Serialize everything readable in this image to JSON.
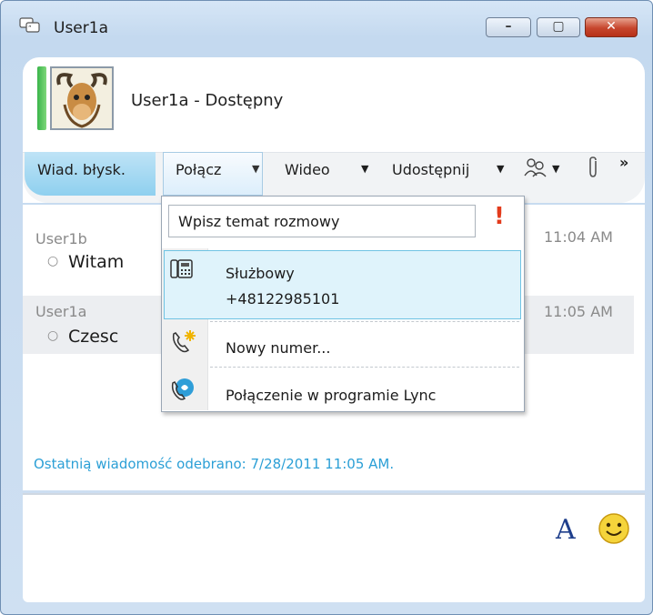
{
  "window": {
    "title": "User1a",
    "minimize_label": "–",
    "maximize_label": "▢",
    "close_label": "✕"
  },
  "contact": {
    "name": "User1a",
    "status": "Dostępny",
    "display": "User1a - Dostępny",
    "presence_color": "#3ab54a"
  },
  "toolbar": {
    "im_label": "Wiad. błysk.",
    "call_label": "Połącz",
    "video_label": "Wideo",
    "share_label": "Udostępnij",
    "people_icon": "people-options-icon",
    "attach_icon": "paperclip-icon",
    "more_label": "»"
  },
  "conversation": {
    "messages": [
      {
        "sender": "User1b",
        "text": "Witam",
        "time": "11:04 AM"
      },
      {
        "sender": "User1a",
        "text": "Czesc",
        "time": "11:05 AM"
      }
    ],
    "status_line": "Ostatnią wiadomość odebrano: 7/28/2011 11:05 AM."
  },
  "call_menu": {
    "topic_placeholder": "Wpisz temat rozmowy",
    "priority_icon": "!",
    "items": [
      {
        "label": "Służbowy",
        "sub": "+48122985101",
        "icon": "desk-phone-icon"
      },
      {
        "label": "Nowy numer...",
        "icon": "new-number-phone-icon"
      },
      {
        "label": "Połączenie w programie Lync",
        "icon": "lync-call-icon"
      }
    ]
  },
  "input": {
    "font_label": "A",
    "emoticon_icon": "smiley-icon"
  },
  "colors": {
    "accent": "#2b9fd6",
    "highlight": "#dff3fb",
    "close_button": "#c6452d"
  }
}
